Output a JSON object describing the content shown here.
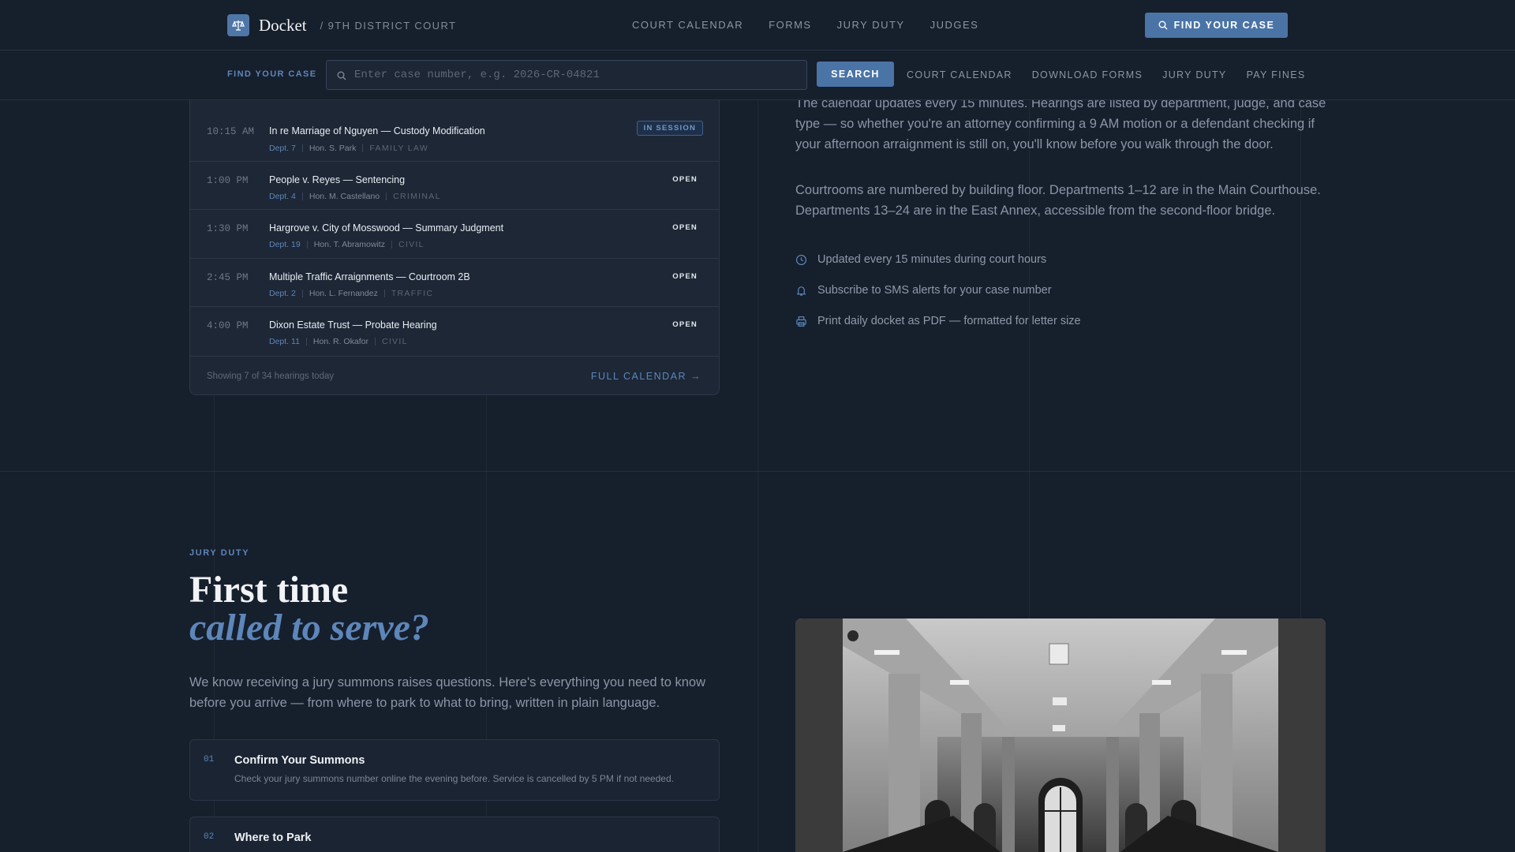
{
  "nav": {
    "brand": "Docket",
    "subtitle": "/ 9TH DISTRICT COURT",
    "links": [
      "COURT CALENDAR",
      "FORMS",
      "JURY DUTY",
      "JUDGES"
    ],
    "cta": "FIND YOUR CASE"
  },
  "search": {
    "label": "FIND YOUR CASE",
    "placeholder": "Enter case number, e.g. 2026-CR-04821",
    "button": "SEARCH",
    "links": [
      "COURT CALENDAR",
      "DOWNLOAD FORMS",
      "JURY DUTY",
      "PAY FINES"
    ]
  },
  "hearings": [
    {
      "time": "10:15 AM",
      "title": "In re Marriage of Nguyen — Custody Modification",
      "dept": "Dept. 7",
      "judge": "Hon. S. Park",
      "type": "FAMILY LAW",
      "status": "IN SESSION"
    },
    {
      "time": "1:00 PM",
      "title": "People v. Reyes — Sentencing",
      "dept": "Dept. 4",
      "judge": "Hon. M. Castellano",
      "type": "CRIMINAL",
      "status": "OPEN"
    },
    {
      "time": "1:30 PM",
      "title": "Hargrove v. City of Mosswood — Summary Judgment",
      "dept": "Dept. 19",
      "judge": "Hon. T. Abramowitz",
      "type": "CIVIL",
      "status": "OPEN"
    },
    {
      "time": "2:45 PM",
      "title": "Multiple Traffic Arraignments — Courtroom 2B",
      "dept": "Dept. 2",
      "judge": "Hon. L. Fernandez",
      "type": "TRAFFIC",
      "status": "OPEN"
    },
    {
      "time": "4:00 PM",
      "title": "Dixon Estate Trust — Probate Hearing",
      "dept": "Dept. 11",
      "judge": "Hon. R. Okafor",
      "type": "CIVIL",
      "status": "OPEN"
    }
  ],
  "card_footer": {
    "count": "Showing 7 of 34 hearings today",
    "full_calendar": "FULL CALENDAR →"
  },
  "info": {
    "para1": "The calendar updates every 15 minutes. Hearings are listed by department, judge, and case type — so whether you're an attorney confirming a 9 AM motion or a defendant checking if your afternoon arraignment is still on, you'll know before you walk through the door.",
    "para2": "Courtrooms are numbered by building floor. Departments 1–12 are in the Main Courthouse. Departments 13–24 are in the East Annex, accessible from the second-floor bridge.",
    "features": [
      "Updated every 15 minutes during court hours",
      "Subscribe to SMS alerts for your case number",
      "Print daily docket as PDF — formatted for letter size"
    ]
  },
  "jury": {
    "eyebrow": "JURY DUTY",
    "heading_line1": "First time",
    "heading_line2": "called to serve?",
    "para": "We know receiving a jury summons raises questions. Here's everything you need to know before you arrive — from where to park to what to bring, written in plain language.",
    "steps": [
      {
        "num": "01",
        "title": "Confirm Your Summons",
        "desc": "Check your jury summons number online the evening before. Service is cancelled by 5 PM if not needed."
      },
      {
        "num": "02",
        "title": "Where to Park",
        "desc": ""
      }
    ]
  },
  "colors": {
    "background": "#161f2c",
    "accent": "#4a74a6",
    "accent_text": "#5d86ba",
    "card": "#1d2736"
  }
}
